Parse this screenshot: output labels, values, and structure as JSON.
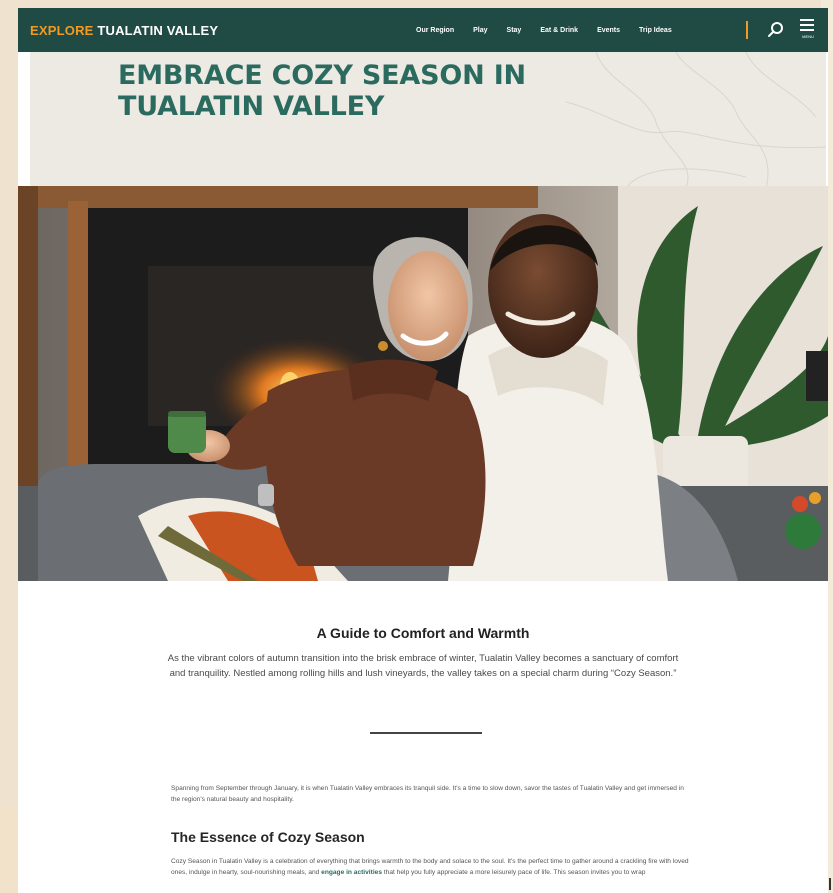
{
  "nav": {
    "logo_part1": "EXPLORE",
    "logo_part2": "TUALATIN VALLEY",
    "links": [
      "Our Region",
      "Play",
      "Stay",
      "Eat & Drink",
      "Events",
      "Trip Ideas"
    ],
    "menu_label": "MENU",
    "search_icon": "search-icon",
    "menu_icon": "hamburger-menu-icon"
  },
  "hero": {
    "title": "EMBRACE COZY SEASON IN TUALATIN VALLEY"
  },
  "content": {
    "heading": "A Guide to Comfort and Warmth",
    "lead": "As the vibrant colors of autumn transition into the brisk embrace of winter, Tualatin Valley becomes a sanctuary of comfort and tranquility. Nestled among rolling hills and lush vineyards, the valley takes on a special charm during “Cozy Season.”",
    "paragraph1": "Spanning from September through January, it is when Tualatin Valley embraces its tranquil side. It's a time to slow down, savor the tastes of Tualatin Valley and get immersed in the region's natural beauty and hospitality.",
    "subheading": "The Essence of Cozy Season",
    "paragraph2_a": "Cozy Season in Tualatin Valley is a celebration of everything that brings warmth to the body and solace to the soul. It's the perfect time to gather around a crackling fire with loved ones, indulge in hearty, soul-nourishing meals, and ",
    "paragraph2_link": "engage in activities",
    "paragraph2_b": " that help you fully appreciate a more leisurely pace of life. This season invites you to wrap"
  },
  "colors": {
    "nav_bg": "#1f4b44",
    "logo_accent": "#f29a22",
    "title_green": "#2b6b5f",
    "hero_bg": "#eceae2"
  }
}
